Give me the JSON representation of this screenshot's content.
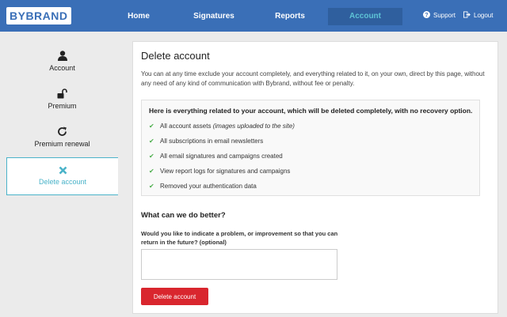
{
  "brand": {
    "logo_text": "BYBRAND"
  },
  "nav": {
    "items": [
      {
        "label": "Home"
      },
      {
        "label": "Signatures"
      },
      {
        "label": "Reports"
      },
      {
        "label": "Account"
      }
    ],
    "support_label": "Support",
    "logout_label": "Logout"
  },
  "sidebar": {
    "items": [
      {
        "label": "Account",
        "icon": "user-icon"
      },
      {
        "label": "Premium",
        "icon": "unlock-icon"
      },
      {
        "label": "Premium renewal",
        "icon": "refresh-icon"
      },
      {
        "label": "Delete account",
        "icon": "close-icon"
      }
    ]
  },
  "main": {
    "title": "Delete account",
    "intro": "You can at any time exclude your account completely, and everything related to it, on your own, direct by this page, without any need of any kind of communication with Bybrand, without fee or penalty.",
    "box_heading": "Here is everything related to your account, which will be deleted completely, with no recovery option.",
    "list": [
      {
        "text": "All account assets ",
        "note": "(images uploaded to the site)"
      },
      {
        "text": "All subscriptions in email newsletters",
        "note": ""
      },
      {
        "text": "All email signatures and campaigns created",
        "note": ""
      },
      {
        "text": "View report logs for signatures and campaigns",
        "note": ""
      },
      {
        "text": "Removed your authentication data",
        "note": ""
      }
    ],
    "feedback_heading": "What can we do better?",
    "feedback_question": "Would you like to indicate a problem, or improvement so that you can return in the future? (optional)",
    "feedback_value": "",
    "delete_button": "Delete account"
  },
  "colors": {
    "topbar": "#3a6fb7",
    "accent": "#4ab3c9",
    "danger": "#d9262e",
    "check": "#4cae4c"
  }
}
